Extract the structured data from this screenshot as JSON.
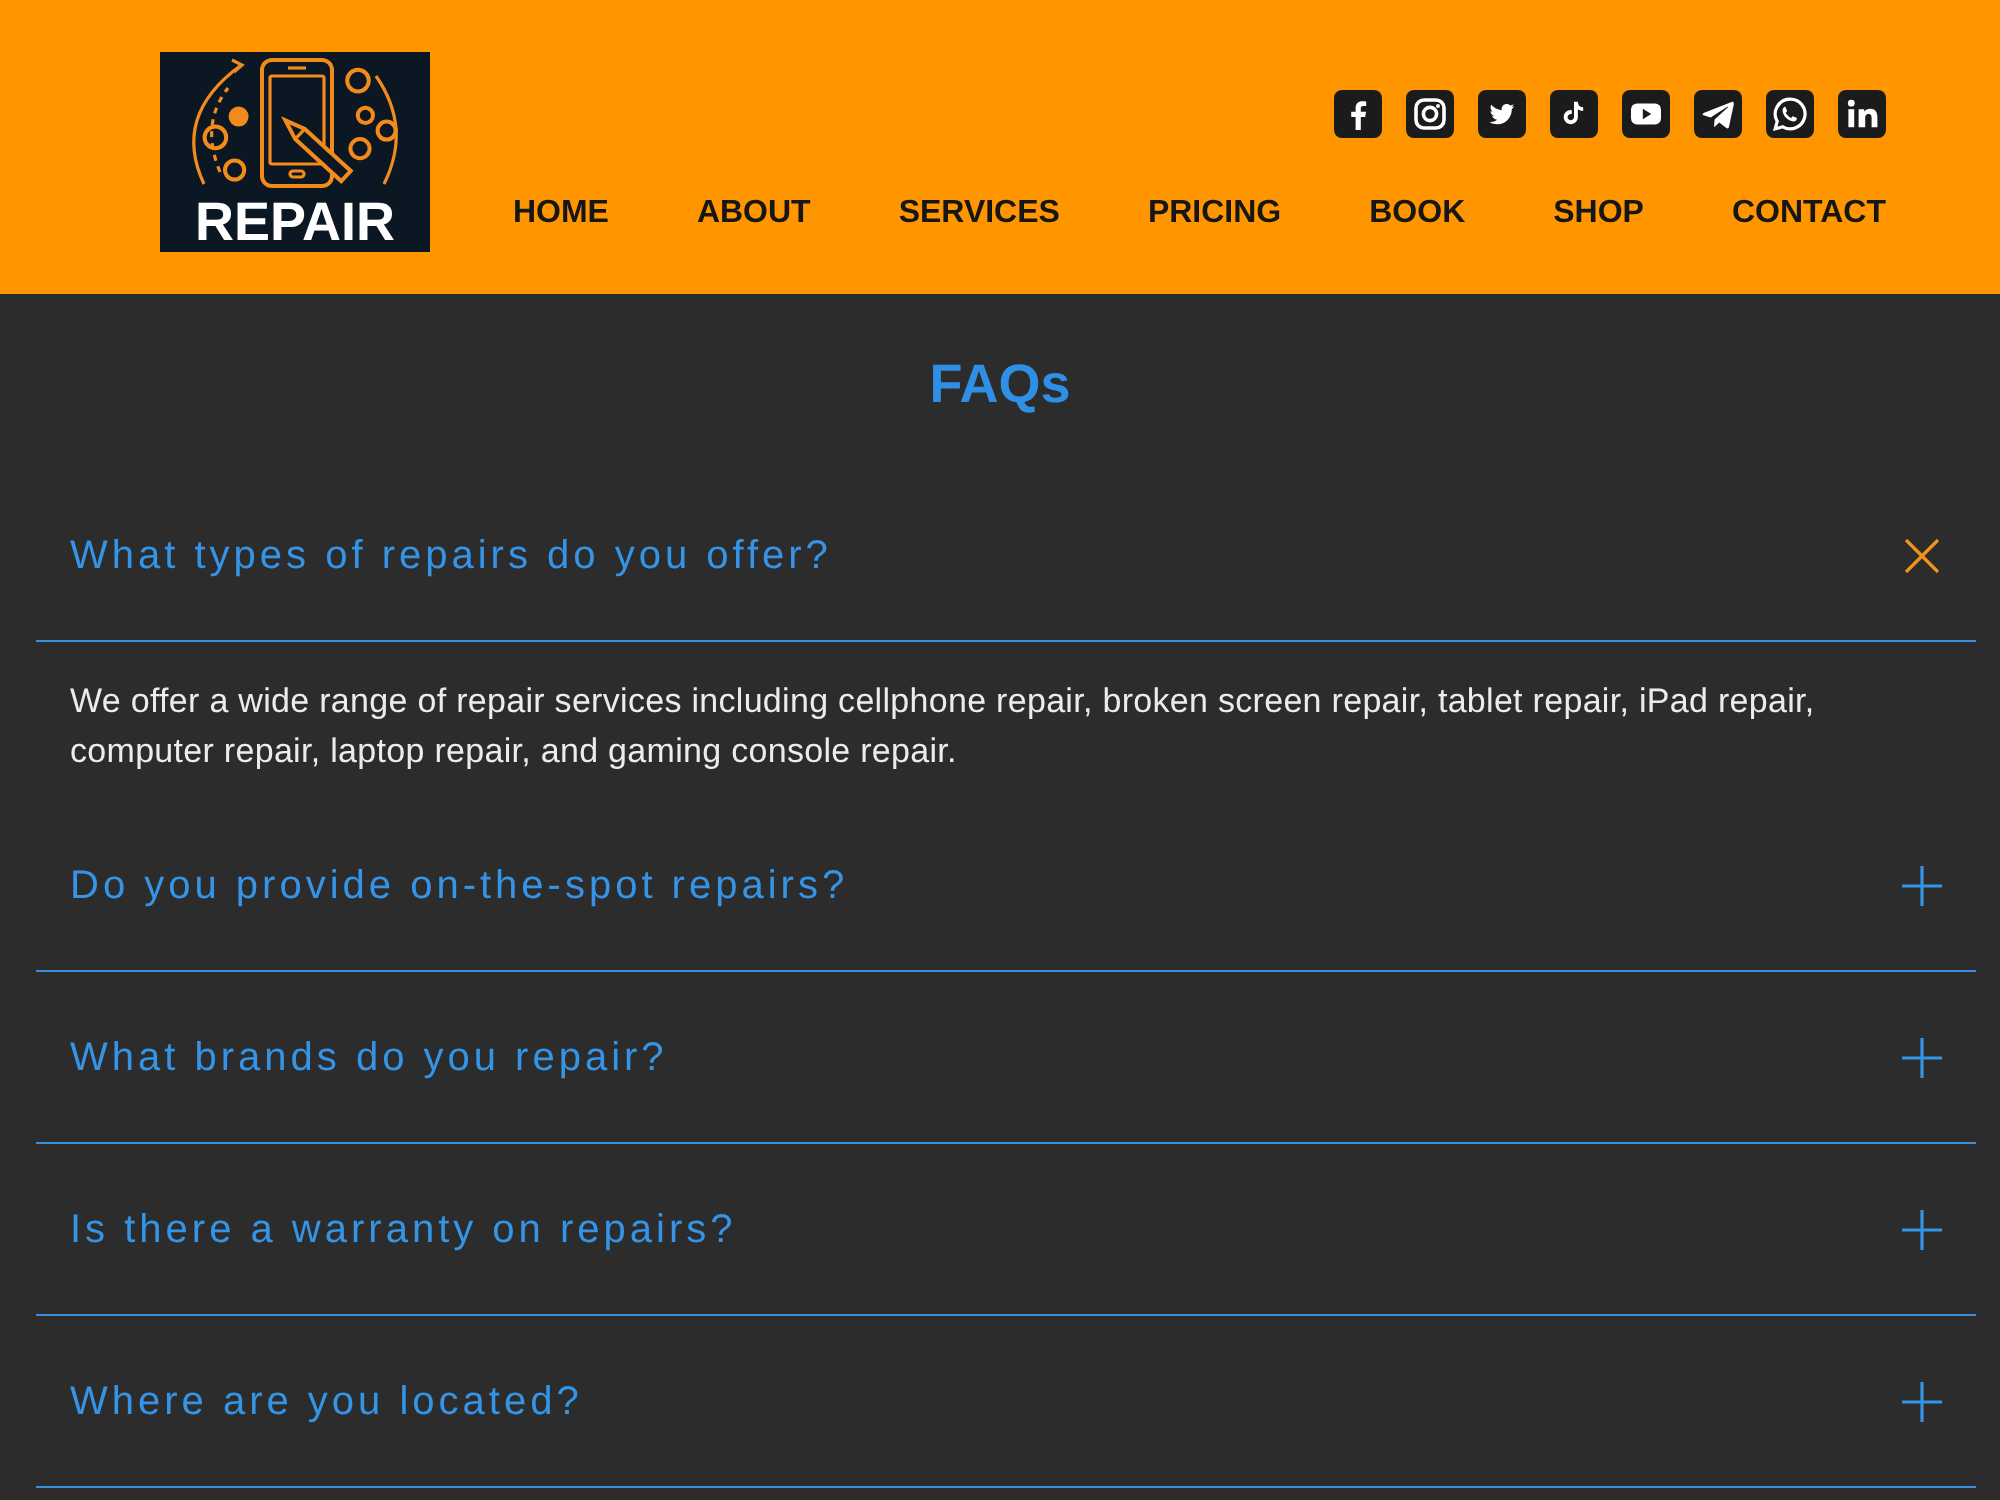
{
  "header": {
    "logo_text": "REPAIR",
    "nav": [
      "HOME",
      "ABOUT",
      "SERVICES",
      "PRICING",
      "BOOK",
      "SHOP",
      "CONTACT"
    ]
  },
  "faq": {
    "title": "FAQs",
    "items": [
      {
        "question": "What types of repairs do you offer?",
        "expanded": true,
        "answer": "We offer a wide range of repair services including cellphone repair, broken screen repair, tablet repair, iPad repair, computer repair, laptop repair, and gaming console repair."
      },
      {
        "question": "Do you provide on-the-spot repairs?",
        "expanded": false
      },
      {
        "question": "What brands do you repair?",
        "expanded": false
      },
      {
        "question": "Is there a warranty on repairs?",
        "expanded": false
      },
      {
        "question": "Where are you located?",
        "expanded": false
      }
    ]
  }
}
